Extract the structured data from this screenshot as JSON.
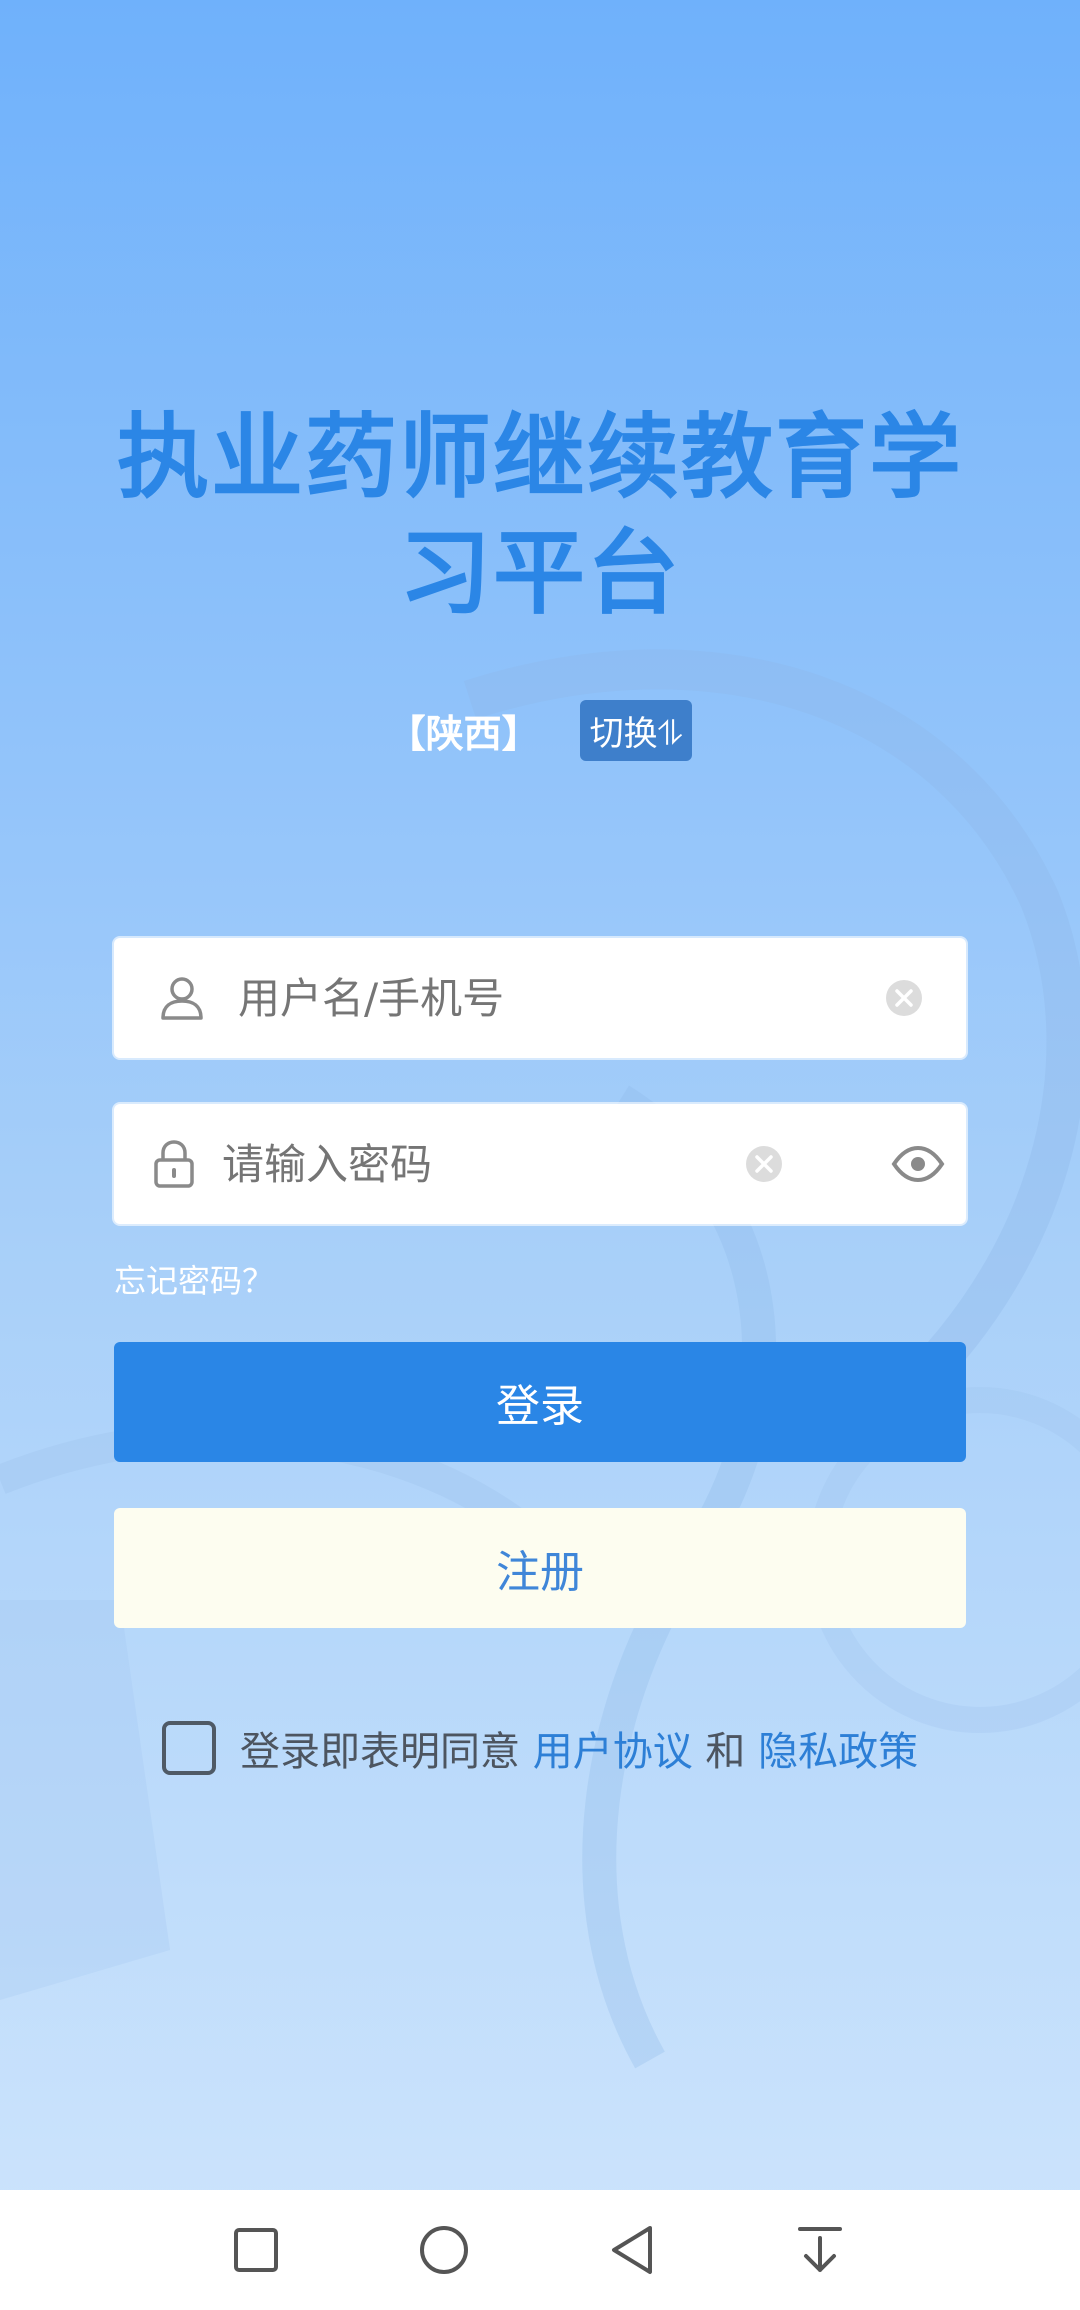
{
  "app": {
    "title_line1": "执业药师继续教育学",
    "title_line2": "习平台",
    "region": "【陕西】",
    "switch_label": "切换⥮"
  },
  "login_form": {
    "username_placeholder": "用户名/手机号",
    "password_placeholder": "请输入密码",
    "forgot_label": "忘记密码？",
    "login_label": "登录",
    "register_label": "注册"
  },
  "agreement": {
    "prefix": "登录即表明同意 ",
    "user_agreement": "用户协议",
    "conjunction": " 和 ",
    "privacy_policy": "隐私政策",
    "checked": false
  },
  "colors": {
    "title": "#2b86e6",
    "primary_button": "#2a86e6",
    "link": "#2d7fd6"
  },
  "icons": {
    "username": "user-icon",
    "password": "lock-icon",
    "clear": "clear-icon",
    "visibility": "eye-icon",
    "nav": [
      "recents-icon",
      "home-icon",
      "back-icon",
      "notification-pull-icon"
    ]
  }
}
